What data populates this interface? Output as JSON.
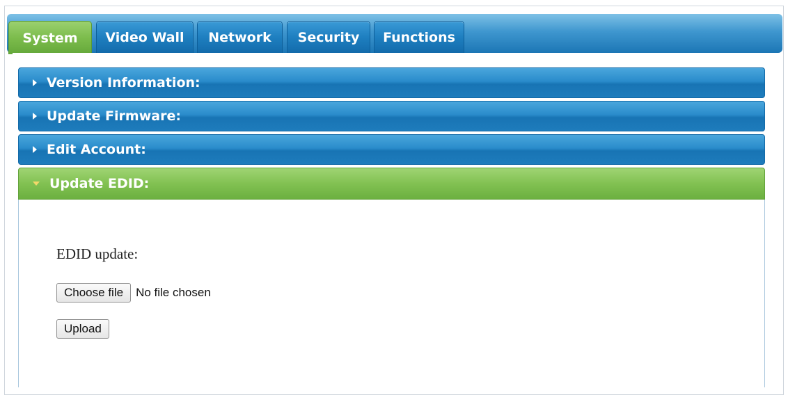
{
  "tabs": [
    {
      "label": "System",
      "active": true
    },
    {
      "label": "Video Wall",
      "active": false
    },
    {
      "label": "Network",
      "active": false
    },
    {
      "label": "Security",
      "active": false
    },
    {
      "label": "Functions",
      "active": false
    }
  ],
  "accordion": [
    {
      "label": "Version Information:",
      "expanded": false
    },
    {
      "label": "Update Firmware:",
      "expanded": false
    },
    {
      "label": "Edit Account:",
      "expanded": false
    },
    {
      "label": "Update EDID:",
      "expanded": true
    }
  ],
  "edid_panel": {
    "label": "EDID update:",
    "choose_file_label": "Choose file",
    "file_status": "No file chosen",
    "upload_label": "Upload"
  },
  "colors": {
    "tab_blue": "#1e7fc0",
    "tab_green": "#7cbc4c",
    "accordion_blue": "#2a8ccb",
    "accordion_green": "#82c152"
  },
  "icons": {
    "collapsed": "caret-right-icon",
    "expanded": "caret-down-icon"
  }
}
